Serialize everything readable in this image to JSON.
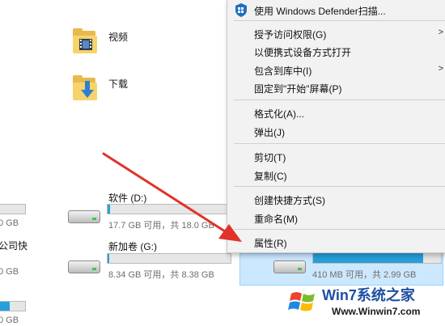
{
  "folders": [
    {
      "label": "视频",
      "icon": "video-folder-icon"
    },
    {
      "label": "下载",
      "icon": "download-folder-icon"
    }
  ],
  "left_partial": {
    "size1": "0 GB",
    "name2": "公司快",
    "size2": "0 GB",
    "size3": "0 GB"
  },
  "drives": [
    {
      "name": "软件 (D:)",
      "size_text": "17.7 GB 可用，共 18.0 GB",
      "used_fraction": 0.02
    },
    {
      "name": "新加卷 (G:)",
      "size_text": "8.34 GB 可用，共 8.38 GB",
      "used_fraction": 0.01
    }
  ],
  "selected_drive": {
    "size_text": "410 MB 可用，共 2.99 GB",
    "used_fraction": 0.86
  },
  "context_menu": {
    "items": [
      {
        "label": "使用 Windows Defender扫描...",
        "icon": "windows-defender-icon",
        "submenu": false
      },
      {
        "label": "授予访问权限(G)",
        "submenu": true
      },
      {
        "label": "以便携式设备方式打开",
        "submenu": false
      },
      {
        "label": "包含到库中(I)",
        "submenu": true
      },
      {
        "label": "固定到\"开始\"屏幕(P)",
        "submenu": false
      },
      {
        "label": "格式化(A)...",
        "submenu": false
      },
      {
        "label": "弹出(J)",
        "submenu": false
      },
      {
        "label": "剪切(T)",
        "submenu": false
      },
      {
        "label": "复制(C)",
        "submenu": false
      },
      {
        "label": "创建快捷方式(S)",
        "submenu": false
      },
      {
        "label": "重命名(M)",
        "submenu": false
      },
      {
        "label": "属性(R)",
        "submenu": false
      }
    ]
  },
  "annotation": {
    "color": "#e0322b",
    "icon": "red-arrow-icon"
  },
  "watermark": {
    "title": "Win7系统之家",
    "url": "Www.Winwin7.com",
    "icon": "windows-logo-icon"
  },
  "colors": {
    "accent": "#26a0da",
    "selection": "#cce8ff",
    "menu_bg": "#f2f2f2"
  }
}
